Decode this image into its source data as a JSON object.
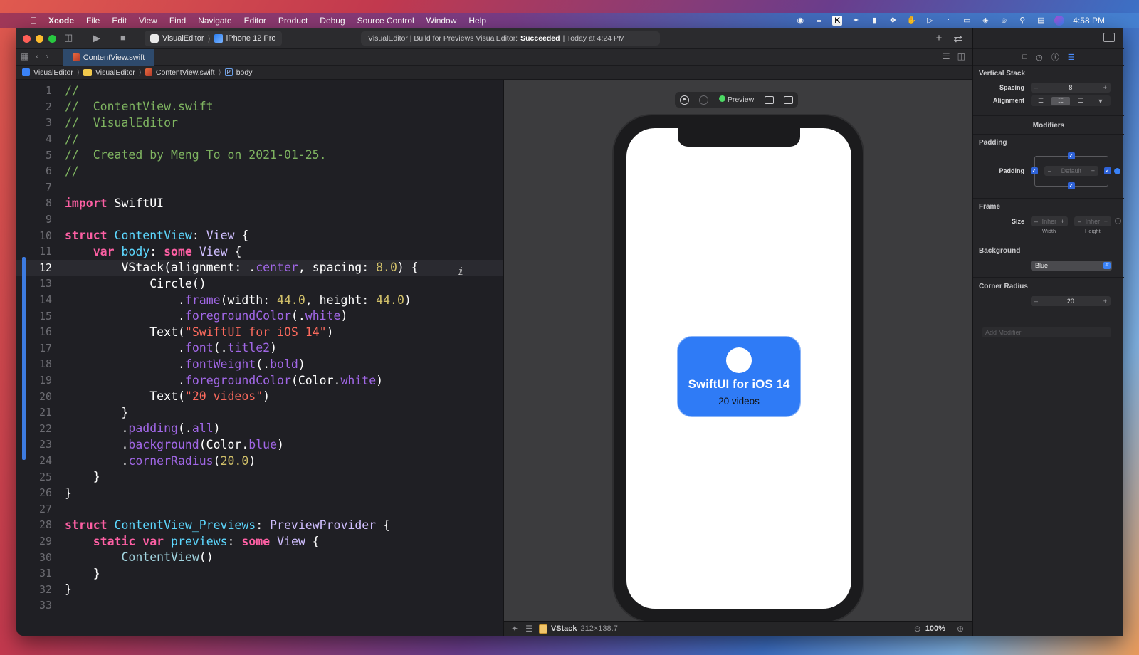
{
  "menubar": {
    "app_name": "Xcode",
    "items": [
      "File",
      "Edit",
      "View",
      "Find",
      "Navigate",
      "Editor",
      "Product",
      "Debug",
      "Source Control",
      "Window",
      "Help"
    ],
    "status_icons": [
      "screen-record-icon",
      "list-icon",
      "k-app-icon",
      "magic-wand-icon",
      "layout-icon",
      "dropbox-icon",
      "hand-icon",
      "play-circle-icon",
      "bluetooth-icon",
      "battery-icon",
      "wifi-icon",
      "user-icon",
      "search-icon",
      "control-center-icon",
      "siri-icon"
    ],
    "clock": "4:58 PM"
  },
  "toolbar": {
    "scheme_project": "VisualEditor",
    "scheme_device": "iPhone 12 Pro",
    "activity_prefix": "VisualEditor | Build for Previews VisualEditor:",
    "activity_status": "Succeeded",
    "activity_suffix": "| Today at 4:24 PM"
  },
  "tabs": [
    {
      "label": "ContentView.swift",
      "active": true
    }
  ],
  "jumpbar": [
    "VisualEditor",
    "VisualEditor",
    "ContentView.swift",
    "body"
  ],
  "editor": {
    "current_line": 12,
    "lines": [
      {
        "n": "1",
        "html": "<span class='c-com'>//</span>"
      },
      {
        "n": "2",
        "html": "<span class='c-com'>//  ContentView.swift</span>"
      },
      {
        "n": "3",
        "html": "<span class='c-com'>//  VisualEditor</span>"
      },
      {
        "n": "4",
        "html": "<span class='c-com'>//</span>"
      },
      {
        "n": "5",
        "html": "<span class='c-com'>//  Created by Meng To on 2021-01-25.</span>"
      },
      {
        "n": "6",
        "html": "<span class='c-com'>//</span>"
      },
      {
        "n": "7",
        "html": ""
      },
      {
        "n": "8",
        "html": "<span class='c-kw'>import</span> SwiftUI"
      },
      {
        "n": "9",
        "html": ""
      },
      {
        "n": "10",
        "html": "<span class='c-kw'>struct</span> <span class='c-type'>ContentView</span>: <span class='c-type2'>View</span> {"
      },
      {
        "n": "11",
        "html": "    <span class='c-kw'>var</span> <span class='c-type'>body</span>: <span class='c-kw'>some</span> <span class='c-type2'>View</span> {"
      },
      {
        "n": "12",
        "html": "        VStack(alignment: .<span class='c-prop'>center</span>, spacing: <span class='c-num'>8.0</span>) {"
      },
      {
        "n": "13",
        "html": "            Circle()"
      },
      {
        "n": "14",
        "html": "                .<span class='c-prop'>frame</span>(width: <span class='c-num'>44.0</span>, height: <span class='c-num'>44.0</span>)"
      },
      {
        "n": "15",
        "html": "                .<span class='c-prop'>foregroundColor</span>(.<span class='c-prop'>white</span>)"
      },
      {
        "n": "16",
        "html": "            Text(<span class='c-str'>\"SwiftUI for iOS 14\"</span>)"
      },
      {
        "n": "17",
        "html": "                .<span class='c-prop'>font</span>(.<span class='c-prop'>title2</span>)"
      },
      {
        "n": "18",
        "html": "                .<span class='c-prop'>fontWeight</span>(.<span class='c-prop'>bold</span>)"
      },
      {
        "n": "19",
        "html": "                .<span class='c-prop'>foregroundColor</span>(Color.<span class='c-prop'>white</span>)"
      },
      {
        "n": "20",
        "html": "            Text(<span class='c-str'>\"20 videos\"</span>)"
      },
      {
        "n": "21",
        "html": "        }"
      },
      {
        "n": "22",
        "html": "        .<span class='c-prop'>padding</span>(.<span class='c-prop'>all</span>)"
      },
      {
        "n": "23",
        "html": "        .<span class='c-prop'>background</span>(Color.<span class='c-prop'>blue</span>)"
      },
      {
        "n": "24",
        "html": "        .<span class='c-prop'>cornerRadius</span>(<span class='c-num'>20.0</span>)"
      },
      {
        "n": "25",
        "html": "    }"
      },
      {
        "n": "26",
        "html": "}"
      },
      {
        "n": "27",
        "html": ""
      },
      {
        "n": "28",
        "html": "<span class='c-kw'>struct</span> <span class='c-type'>ContentView_Previews</span>: <span class='c-type2'>PreviewProvider</span> {"
      },
      {
        "n": "29",
        "html": "    <span class='c-kw'>static</span> <span class='c-kw'>var</span> <span class='c-type'>previews</span>: <span class='c-kw'>some</span> <span class='c-type2'>View</span> {"
      },
      {
        "n": "30",
        "html": "        <span class='c-fn'>ContentView</span>()"
      },
      {
        "n": "31",
        "html": "    }"
      },
      {
        "n": "32",
        "html": "}"
      },
      {
        "n": "33",
        "html": ""
      }
    ]
  },
  "canvas": {
    "preview_label": "Preview",
    "card_title": "SwiftUI for iOS 14",
    "card_subtitle": "20 videos",
    "card_color": "#2f7bf6",
    "footer_element": "VStack",
    "footer_size": "212×138.7",
    "zoom": "100%"
  },
  "inspector": {
    "title": "Vertical Stack",
    "spacing_label": "Spacing",
    "spacing_value": "8",
    "alignment_label": "Alignment",
    "alignment_selected": "center",
    "modifiers_title": "Modifiers",
    "padding_title": "Padding",
    "padding_label": "Padding",
    "padding_placeholder": "Default",
    "frame_title": "Frame",
    "size_label": "Size",
    "width_placeholder": "Inher",
    "height_placeholder": "Inher",
    "width_label": "Width",
    "height_label": "Height",
    "background_title": "Background",
    "background_value": "Blue",
    "corner_title": "Corner Radius",
    "corner_value": "20",
    "add_modifier_placeholder": "Add Modifier"
  }
}
